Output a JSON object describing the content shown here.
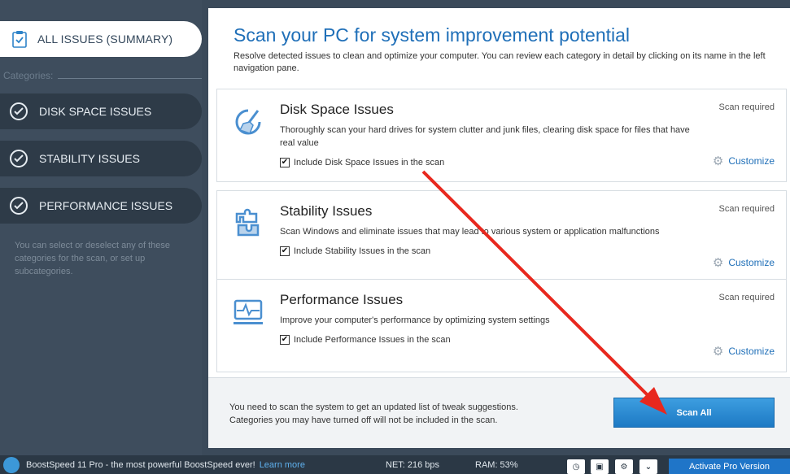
{
  "sidebar": {
    "summary_label": "ALL ISSUES (SUMMARY)",
    "categories_label": "Categories:",
    "items": [
      {
        "label": "DISK SPACE ISSUES"
      },
      {
        "label": "STABILITY ISSUES"
      },
      {
        "label": "PERFORMANCE ISSUES"
      }
    ],
    "note": "You can select or deselect any of these categories for the scan, or set up subcategories."
  },
  "main": {
    "title": "Scan your PC for system improvement potential",
    "subtitle": "Resolve detected issues to clean and optimize your computer. You can review each category in detail by clicking on its name in the left navigation pane.",
    "cards": [
      {
        "title": "Disk Space Issues",
        "description": "Thoroughly scan your hard drives for system clutter and junk files, clearing disk space for files that have real value",
        "checkbox_label": "Include Disk Space Issues in the scan",
        "checked": true,
        "status": "Scan required",
        "customize_label": "Customize",
        "icon": "broom-icon"
      },
      {
        "title": "Stability Issues",
        "description": "Scan Windows and eliminate issues that may lead to various system or application malfunctions",
        "checkbox_label": "Include Stability Issues in the scan",
        "checked": true,
        "status": "Scan required",
        "customize_label": "Customize",
        "icon": "puzzle-icon"
      },
      {
        "title": "Performance Issues",
        "description": "Improve your computer's performance by optimizing system settings",
        "checkbox_label": "Include Performance Issues in the scan",
        "checked": true,
        "status": "Scan required",
        "customize_label": "Customize",
        "icon": "monitor-pulse-icon"
      }
    ],
    "footer": {
      "line1": "You need to scan the system to get an updated list of tweak suggestions.",
      "line2": "Categories you may have turned off will not be included in the scan.",
      "scan_button": "Scan All"
    }
  },
  "statusbar": {
    "promo": "BoostSpeed 11 Pro - the most powerful BoostSpeed ever!",
    "learn_more": "Learn more",
    "net": "NET: 216 bps",
    "ram": "RAM: 53%",
    "activate": "Activate Pro Version"
  },
  "colors": {
    "accent": "#1f6fb8",
    "sidebar_bg": "#3e4d5d",
    "annotation_arrow": "#e8281e"
  }
}
